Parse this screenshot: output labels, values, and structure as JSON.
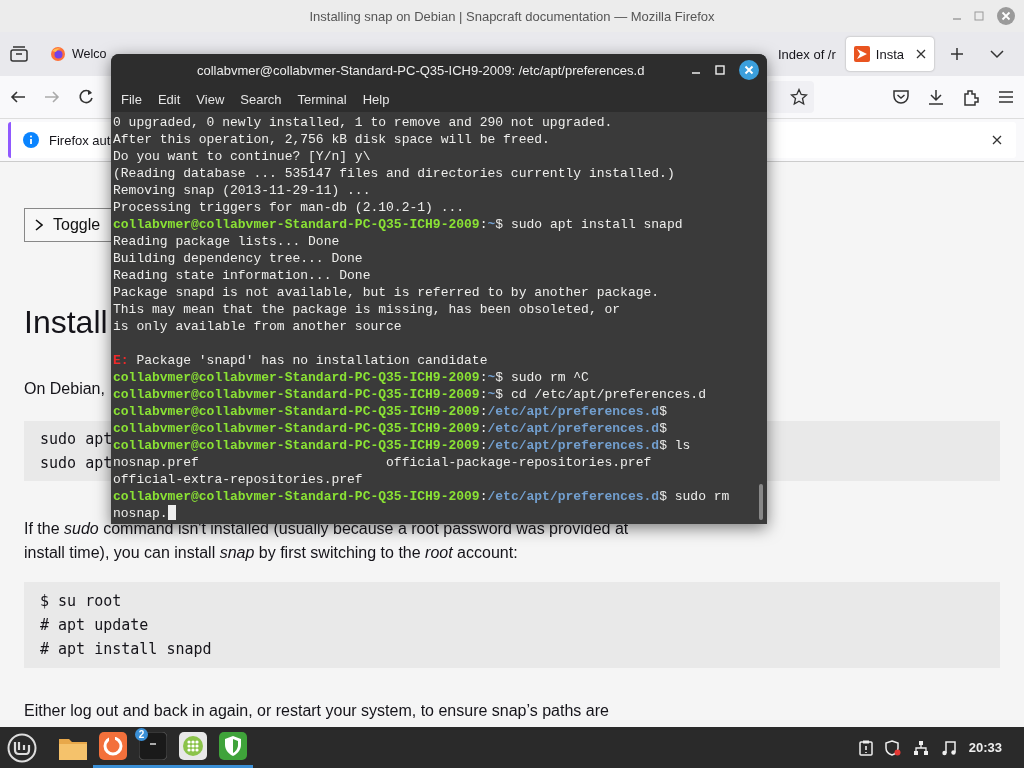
{
  "browser": {
    "title": "Installing snap on Debian | Snapcraft documentation — Mozilla Firefox",
    "tabs": [
      {
        "label": "Welco",
        "selected": false,
        "kind": "firefox"
      },
      {
        "label": "Index of /r",
        "selected": false,
        "kind": "plain"
      },
      {
        "label": "Insta",
        "selected": true,
        "kind": "snap"
      }
    ],
    "forward_disabled": true,
    "notification": {
      "text": "Firefox aut"
    },
    "page": {
      "toggle": "Toggle",
      "heading": "Install",
      "intro": "On Debian,",
      "code_1": [
        "sudo apt",
        "sudo apt"
      ],
      "para_1": [
        "If the *sudo* command isn't installed (usually because a root password was provided at",
        "install time), you can install *snap* by first switching to the *root* account:"
      ],
      "code_2": [
        "$ su root",
        "# apt update",
        "# apt install snapd"
      ],
      "para_2": "Either log out and back in again, or restart your system, to ensure snap’s paths are"
    }
  },
  "terminal": {
    "title": "collabvmer@collabvmer-Standard-PC-Q35-ICH9-2009: /etc/apt/preferences.d",
    "menu": [
      "File",
      "Edit",
      "View",
      "Search",
      "Terminal",
      "Help"
    ],
    "lines": [
      {
        "kind": "text",
        "segments": [
          {
            "kind": "plain",
            "text": "0 upgraded, 0 newly installed, 1 to remove and 290 not upgraded."
          }
        ]
      },
      {
        "kind": "text",
        "segments": [
          {
            "kind": "plain",
            "text": "After this operation, 2,756 kB disk space will be freed."
          }
        ]
      },
      {
        "kind": "text",
        "segments": [
          {
            "kind": "plain",
            "text": "Do you want to continue? [Y/n] y\\"
          }
        ]
      },
      {
        "kind": "text",
        "segments": [
          {
            "kind": "plain",
            "text": "(Reading database ... 535147 files and directories currently installed.)"
          }
        ]
      },
      {
        "kind": "text",
        "segments": [
          {
            "kind": "plain",
            "text": "Removing snap (2013-11-29-11) ..."
          }
        ]
      },
      {
        "kind": "text",
        "segments": [
          {
            "kind": "plain",
            "text": "Processing triggers for man-db (2.10.2-1) ..."
          }
        ]
      },
      {
        "kind": "text",
        "segments": [
          {
            "kind": "user",
            "text": "collabvmer@collabvmer-Standard-PC-Q35-ICH9-2009"
          },
          {
            "kind": "plain",
            "text": ":"
          },
          {
            "kind": "path",
            "text": "~"
          },
          {
            "kind": "plain",
            "text": "$ sudo apt install snapd"
          }
        ]
      },
      {
        "kind": "text",
        "segments": [
          {
            "kind": "plain",
            "text": "Reading package lists... Done"
          }
        ]
      },
      {
        "kind": "text",
        "segments": [
          {
            "kind": "plain",
            "text": "Building dependency tree... Done"
          }
        ]
      },
      {
        "kind": "text",
        "segments": [
          {
            "kind": "plain",
            "text": "Reading state information... Done"
          }
        ]
      },
      {
        "kind": "text",
        "segments": [
          {
            "kind": "plain",
            "text": "Package snapd is not available, but is referred to by another package."
          }
        ]
      },
      {
        "kind": "text",
        "segments": [
          {
            "kind": "plain",
            "text": "This may mean that the package is missing, has been obsoleted, or"
          }
        ]
      },
      {
        "kind": "text",
        "segments": [
          {
            "kind": "plain",
            "text": "is only available from another source"
          }
        ]
      },
      {
        "kind": "blank"
      },
      {
        "kind": "text",
        "segments": [
          {
            "kind": "error",
            "text": "E:"
          },
          {
            "kind": "plain",
            "text": " Package 'snapd' has no installation candidate"
          }
        ]
      },
      {
        "kind": "text",
        "segments": [
          {
            "kind": "user",
            "text": "collabvmer@collabvmer-Standard-PC-Q35-ICH9-2009"
          },
          {
            "kind": "plain",
            "text": ":"
          },
          {
            "kind": "path",
            "text": "~"
          },
          {
            "kind": "plain",
            "text": "$ sudo rm ^C"
          }
        ]
      },
      {
        "kind": "text",
        "segments": [
          {
            "kind": "user",
            "text": "collabvmer@collabvmer-Standard-PC-Q35-ICH9-2009"
          },
          {
            "kind": "plain",
            "text": ":"
          },
          {
            "kind": "path",
            "text": "~"
          },
          {
            "kind": "plain",
            "text": "$ cd /etc/apt/preferences.d"
          }
        ]
      },
      {
        "kind": "text",
        "segments": [
          {
            "kind": "user",
            "text": "collabvmer@collabvmer-Standard-PC-Q35-ICH9-2009"
          },
          {
            "kind": "plain",
            "text": ":"
          },
          {
            "kind": "path",
            "text": "/etc/apt/preferences.d"
          },
          {
            "kind": "plain",
            "text": "$"
          }
        ]
      },
      {
        "kind": "text",
        "segments": [
          {
            "kind": "user",
            "text": "collabvmer@collabvmer-Standard-PC-Q35-ICH9-2009"
          },
          {
            "kind": "plain",
            "text": ":"
          },
          {
            "kind": "path",
            "text": "/etc/apt/preferences.d"
          },
          {
            "kind": "plain",
            "text": "$"
          }
        ]
      },
      {
        "kind": "text",
        "segments": [
          {
            "kind": "user",
            "text": "collabvmer@collabvmer-Standard-PC-Q35-ICH9-2009"
          },
          {
            "kind": "plain",
            "text": ":"
          },
          {
            "kind": "path",
            "text": "/etc/apt/preferences.d"
          },
          {
            "kind": "plain",
            "text": "$ ls"
          }
        ]
      },
      {
        "kind": "columns",
        "segments": [
          {
            "kind": "plain",
            "text": "nosnap.pref"
          },
          {
            "kind": "plain",
            "text": "official-package-repositories.pref"
          }
        ]
      },
      {
        "kind": "text",
        "segments": [
          {
            "kind": "plain",
            "text": "official-extra-repositories.pref"
          }
        ]
      },
      {
        "kind": "text",
        "segments": [
          {
            "kind": "user",
            "text": "collabvmer@collabvmer-Standard-PC-Q35-ICH9-2009"
          },
          {
            "kind": "plain",
            "text": ":"
          },
          {
            "kind": "path",
            "text": "/etc/apt/preferences.d"
          },
          {
            "kind": "plain",
            "text": "$ sudo rm"
          }
        ]
      },
      {
        "kind": "text",
        "cursor": true,
        "segments": [
          {
            "kind": "plain",
            "text": "nosnap."
          }
        ]
      }
    ]
  },
  "taskbar": {
    "apps": [
      {
        "kind": "folder",
        "running": false
      },
      {
        "kind": "firefox",
        "running": true
      },
      {
        "kind": "terminal",
        "running": true,
        "badge": "2"
      },
      {
        "kind": "grid",
        "running": true
      },
      {
        "kind": "shield",
        "running": true
      }
    ],
    "clock": "20:33"
  }
}
